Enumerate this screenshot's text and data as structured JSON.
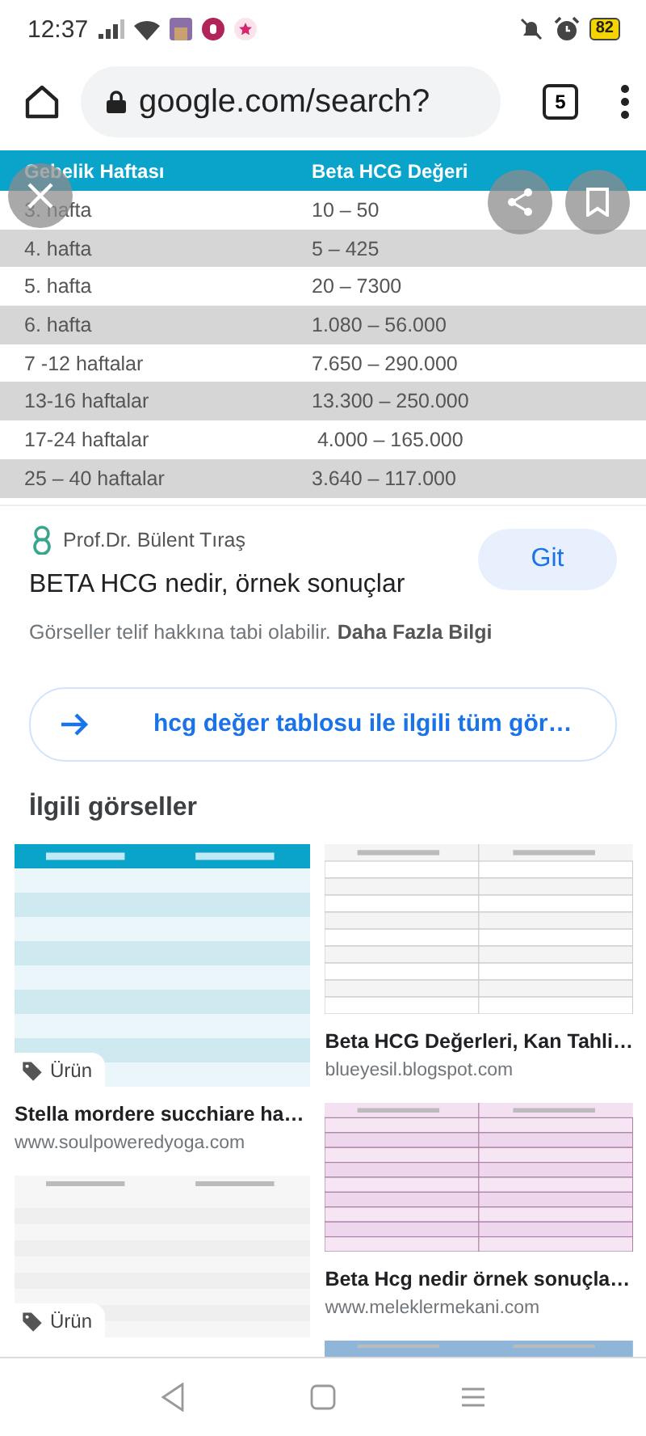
{
  "status_bar": {
    "time": "12:37",
    "battery": "82"
  },
  "browser": {
    "url": "google.com/search?",
    "tab_count": "5"
  },
  "image_table": {
    "columns": [
      "Gebelik Haftası",
      "Beta HCG Değeri"
    ],
    "rows": [
      [
        "3. hafta",
        "10 – 50"
      ],
      [
        "4. hafta",
        "5 – 425"
      ],
      [
        "5. hafta",
        "20 – 7300"
      ],
      [
        "6. hafta",
        "1.080 – 56.000"
      ],
      [
        "7 -12 haftalar",
        "7.650 – 290.000"
      ],
      [
        "13-16 haftalar",
        "13.300 – 250.000"
      ],
      [
        "17-24 haftalar",
        " 4.000 – 165.000"
      ],
      [
        "25 – 40 haftalar",
        "3.640 – 117.000"
      ]
    ]
  },
  "result": {
    "source": "Prof.Dr. Bülent Tıraş",
    "title": "BETA HCG nedir, örnek sonuçlar",
    "notice": "Görseller telif hakkına tabi olabilir.",
    "more_link": "Daha Fazla Bilgi",
    "button": "Git"
  },
  "all_images_link": "hcg değer tablosu ile ilgili tüm gör…",
  "related": {
    "heading": "İlgili görseller",
    "columns": [
      [
        {
          "kind": "teal",
          "badge": "Ürün",
          "title": "Stella mordere succhiare ha…",
          "site": "www.soulpoweredyoga.com"
        },
        {
          "kind": "gray",
          "badge": "Ürün"
        }
      ],
      [
        {
          "kind": "plain",
          "title": "Beta HCG Değerleri, Kan Tahli…",
          "site": "blueyesil.blogspot.com"
        },
        {
          "kind": "pink",
          "title": "Beta Hcg nedir örnek sonuçla…",
          "site": "www.meleklermekani.com"
        },
        {
          "kind": "blue"
        }
      ]
    ]
  }
}
